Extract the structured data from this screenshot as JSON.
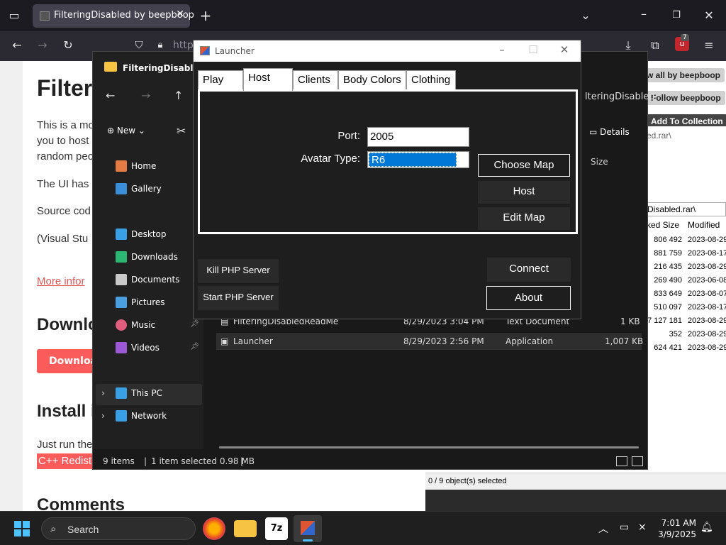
{
  "browser": {
    "tab_title": "FilteringDisabled by beepboop",
    "url_partial": "https",
    "badge_count": "7"
  },
  "webpage": {
    "heading": "Filter",
    "para1_line1": "This is a mo",
    "para1_line2": "you to host",
    "para1_line3": "random peo",
    "para2": "The UI has",
    "para3": "Source cod",
    "para4": "(Visual Stu",
    "more_info": "More infor",
    "download_heading": "Downlo",
    "download_button": "Downloa",
    "install_heading": "Install i",
    "just_run": "Just run the",
    "redist": "C++ Redist",
    "comments_heading": "Comments",
    "view_all": "w all by beepboop",
    "follow": "Follow beepboop",
    "add_collection": "Add To Collection"
  },
  "zip": {
    "path": "Disabled.rar\\",
    "filebox": "ed.rar\\",
    "col_packed": "ked Size",
    "col_modified": "Modified",
    "rows": [
      {
        "size": "806 492",
        "date": "2023-08-29"
      },
      {
        "size": "881 759",
        "date": "2023-08-17"
      },
      {
        "size": "216 435",
        "date": "2023-08-29"
      },
      {
        "size": "269 490",
        "date": "2023-06-08"
      },
      {
        "size": "833 649",
        "date": "2023-08-07"
      },
      {
        "size": "510 097",
        "date": "2023-08-17"
      },
      {
        "size": "7 127 181",
        "date": "2023-08-29"
      },
      {
        "size": "352",
        "date": "2023-08-29"
      },
      {
        "size": "624 421",
        "date": "2023-08-29"
      }
    ],
    "status": "0 / 9 object(s) selected"
  },
  "explorer": {
    "title": "FilteringDisabled",
    "title_right": "lteringDisabled",
    "new_label": "New",
    "details_label": "Details",
    "size_col": "Size",
    "nav": {
      "home": "Home",
      "gallery": "Gallery",
      "desktop": "Desktop",
      "downloads": "Downloads",
      "documents": "Documents",
      "pictures": "Pictures",
      "music": "Music",
      "videos": "Videos",
      "this_pc": "This PC",
      "network": "Network"
    },
    "files": [
      {
        "name": "FilteringDisabledReadMe",
        "date": "8/29/2023 3:04 PM",
        "type": "Text Document",
        "size": "1 KB"
      },
      {
        "name": "Launcher",
        "date": "8/29/2023 2:56 PM",
        "type": "Application",
        "size": "1,007 KB"
      }
    ],
    "status_items": "9 items",
    "status_selected": "1 item selected  0.98 MB"
  },
  "launcher": {
    "title": "Launcher",
    "tabs": [
      "Play",
      "Host",
      "Clients",
      "Body Colors",
      "Clothing"
    ],
    "active_tab": "Host",
    "port_label": "Port:",
    "port_value": "2005",
    "avatar_label": "Avatar Type:",
    "avatar_value": "R6",
    "choose_map": "Choose Map",
    "host": "Host",
    "edit_map": "Edit Map",
    "kill_php": "Kill PHP Server",
    "start_php": "Start PHP Server",
    "connect": "Connect",
    "about": "About"
  },
  "taskbar": {
    "search_placeholder": "Search",
    "time": "7:01 AM",
    "date": "3/9/2025"
  }
}
